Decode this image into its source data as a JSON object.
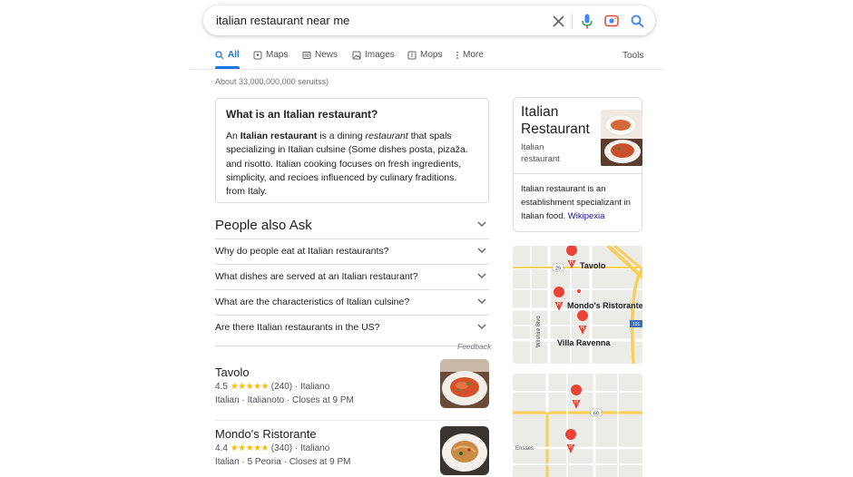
{
  "search": {
    "query": "italian restaurant near me"
  },
  "tabs": [
    {
      "label": "All",
      "icon": "search-icon"
    },
    {
      "label": "Maps",
      "icon": "map-icon"
    },
    {
      "label": "News",
      "icon": "news-icon"
    },
    {
      "label": "Images",
      "icon": "image-icon"
    },
    {
      "label": "Mops",
      "icon": "map-icon"
    },
    {
      "label": "More",
      "icon": "more-vert-icon"
    }
  ],
  "tools_label": "Tools",
  "result_stats": "About 33,000,000,000 seruitss)",
  "snippet": {
    "title": "What is an Italian restaurant?",
    "t1": "An ",
    "t2": "Italian restaurant",
    "t3": " is a dining ",
    "t4": "restaurant",
    "t5": " that spals specializing in Italian culsine (Some dishes posta, pizaža. and risotto. Italian cooking focuses on fresh ingredients, simplicity, and recioes influenced by culinary fraditions. from Italy."
  },
  "paa": {
    "title": "People also Ask",
    "questions": [
      "Why do people eat at Italian restaurants?",
      "What dishes are served at an Italian restaurant?",
      "What are the characteristics of Italian culsine?",
      "Are there Italian restaurants in the US?"
    ],
    "feedback": "Feedback"
  },
  "local": [
    {
      "name": "Tavolo",
      "rating": "4.5",
      "stars": "★★★★★",
      "reviews": "(240) · Italiano",
      "sub": "Italian · Italianoto · Closes at 9 PM"
    },
    {
      "name": "Mondo's Ristorante",
      "rating": "4.4",
      "stars": "★★★★★",
      "reviews": "(340) · Italiano",
      "sub": "Italian · 5 Peoria · Closes at 9 PM"
    }
  ],
  "knowledge_panel": {
    "title_line1": "Italian",
    "title_line2": "Restaurant",
    "sub_line1": "Italian",
    "sub_line2": "restaurant",
    "description": "Italian restaurant is an establishment specializant in Italian food. ",
    "source": "Wikipexia"
  },
  "map1": {
    "labels": [
      "Tavolo",
      "Mondo's Ristorante",
      "Villa Ravenna"
    ],
    "road_labels": [
      "29",
      "Wilshire Blvd",
      "101"
    ]
  },
  "map2": {
    "road_labels": [
      "60",
      "Ensaes"
    ]
  },
  "colors": {
    "accent": "#1a73e8",
    "star": "#fbbc04",
    "pin": "#ea4335",
    "highway": "#f9cf5a",
    "link": "#1a0dab"
  }
}
